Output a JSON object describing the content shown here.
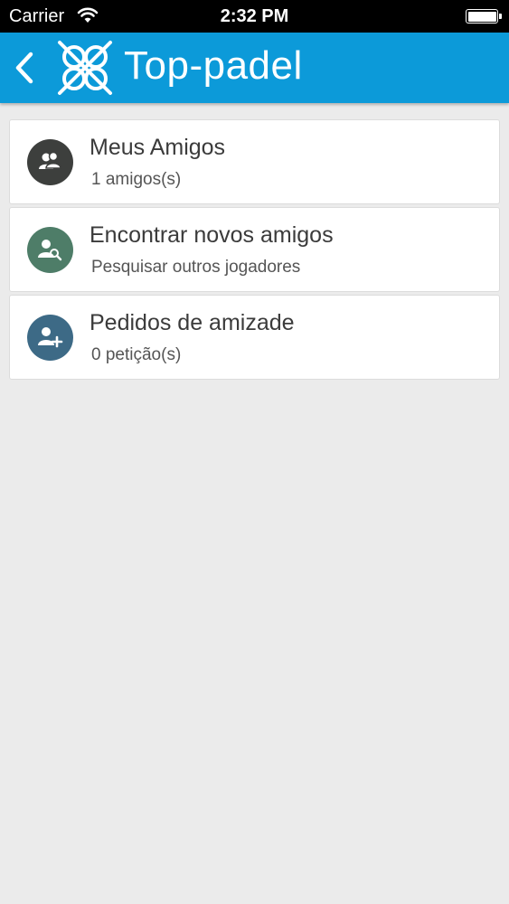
{
  "status_bar": {
    "carrier": "Carrier",
    "time": "2:32 PM"
  },
  "header": {
    "back_icon": "chevron-left-icon",
    "logo_icon": "top-padel-logo-icon",
    "title": "Top-padel",
    "background_color": "#0c9ad9"
  },
  "menu": {
    "items": [
      {
        "title": "Meus Amigos",
        "subtitle": "1 amigos(s)",
        "icon": "friends-icon",
        "icon_color": "#3d3f3d"
      },
      {
        "title": "Encontrar novos amigos",
        "subtitle": "Pesquisar outros jogadores",
        "icon": "search-user-icon",
        "icon_color": "#4e7d68"
      },
      {
        "title": "Pedidos de amizade",
        "subtitle": "0 petição(s)",
        "icon": "add-user-icon",
        "icon_color": "#3d6a86"
      }
    ]
  }
}
